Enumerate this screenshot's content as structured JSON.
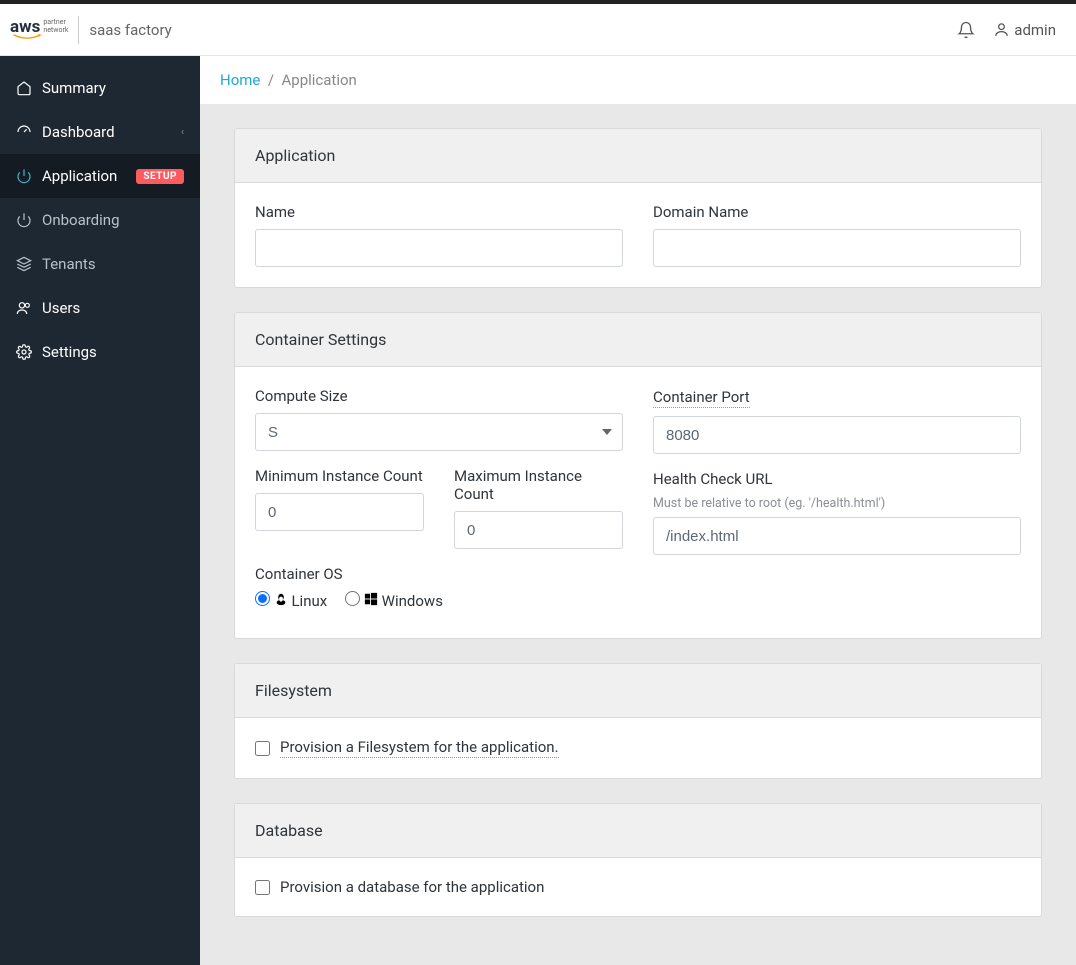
{
  "header": {
    "logo_main": "aws",
    "logo_sub1": "partner",
    "logo_sub2": "network",
    "logo_product": "saas factory",
    "user_label": "admin"
  },
  "sidebar": {
    "items": [
      {
        "label": "Summary",
        "bright": true
      },
      {
        "label": "Dashboard",
        "bright": true,
        "chevron": true
      },
      {
        "label": "Application",
        "bright": true,
        "active": true,
        "badge": "SETUP"
      },
      {
        "label": "Onboarding"
      },
      {
        "label": "Tenants"
      },
      {
        "label": "Users",
        "bright": true
      },
      {
        "label": "Settings",
        "bright": true
      }
    ]
  },
  "breadcrumb": {
    "home": "Home",
    "sep": "/",
    "current": "Application"
  },
  "app_card": {
    "title": "Application",
    "name_label": "Name",
    "domain_label": "Domain Name"
  },
  "container_card": {
    "title": "Container Settings",
    "compute_label": "Compute Size",
    "compute_value": "S",
    "min_label": "Minimum Instance Count",
    "min_value": "0",
    "max_label": "Maximum Instance Count",
    "max_value": "0",
    "os_label": "Container OS",
    "os_linux": "Linux",
    "os_windows": "Windows",
    "port_label": "Container Port",
    "port_value": "8080",
    "health_label": "Health Check URL",
    "health_hint": "Must be relative to root (eg. '/health.html')",
    "health_value": "/index.html"
  },
  "fs_card": {
    "title": "Filesystem",
    "provision_label": "Provision a Filesystem for the application."
  },
  "db_card": {
    "title": "Database",
    "provision_label": "Provision a database for the application"
  }
}
